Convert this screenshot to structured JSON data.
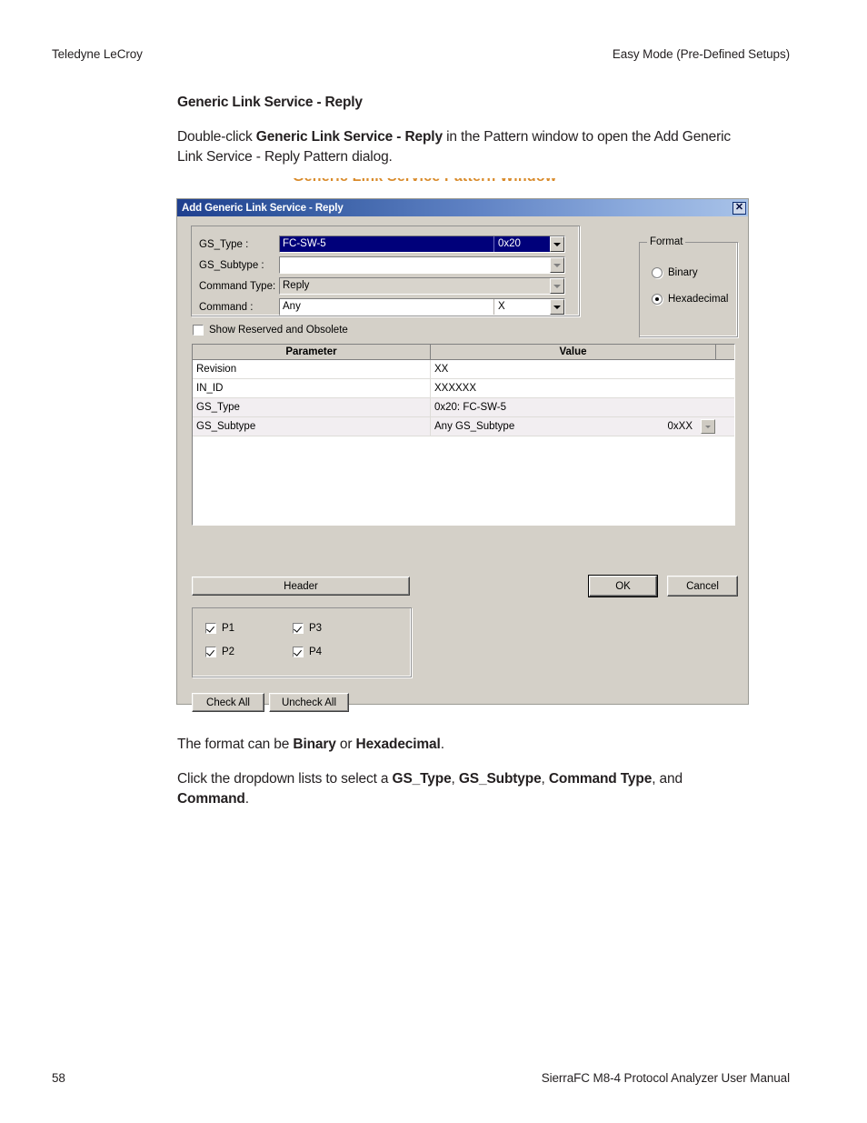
{
  "page": {
    "running_head_left": "Teledyne LeCroy",
    "running_head_right": "Easy Mode (Pre-Defined Setups)",
    "page_number": "58",
    "running_foot_right": "SierraFC M8-4 Protocol Analyzer User Manual",
    "section_title": "Generic Link Service - Reply",
    "paragraph1": {
      "part1": "Double-click ",
      "bold1": "Generic Link Service - Reply",
      "part2": " in the Pattern window to open the Add Generic Link Service - Reply Pattern dialog."
    },
    "clipped_caption": "Generic Link Service Pattern Window",
    "paragraph2": {
      "part1": "The format can be ",
      "bold1": "Binary",
      "part2": " or ",
      "bold2": "Hexadecimal",
      "part3": "."
    },
    "paragraph3": {
      "part1": "Click the dropdown lists to select a ",
      "bold1": "GS_Type",
      "part2": ", ",
      "bold2": "GS_Subtype",
      "part3": ", ",
      "bold3": "Command Type",
      "part4": ", and ",
      "bold4": "Command",
      "part5": "."
    }
  },
  "dialog": {
    "title": "Add Generic Link Service - Reply",
    "close_label": "✕",
    "fields": [
      {
        "label": "GS_Type :",
        "value": "FC-SW-5",
        "aux": "0x20",
        "state": "selected",
        "arrow": "enabled"
      },
      {
        "label": "GS_Subtype :",
        "value": "",
        "aux": "",
        "state": "white",
        "arrow": "disabled"
      },
      {
        "label": "Command Type:",
        "value": "Reply",
        "aux": "",
        "state": "grey",
        "arrow": "disabled"
      },
      {
        "label": "Command :",
        "value": "Any",
        "aux": "X",
        "state": "white",
        "arrow": "enabled"
      }
    ],
    "format": {
      "legend": "Format",
      "options": [
        {
          "label": "Binary",
          "checked": false
        },
        {
          "label": "Hexadecimal",
          "checked": true
        }
      ]
    },
    "show_reserved": {
      "label": "Show Reserved and Obsolete",
      "checked": false
    },
    "table": {
      "headers": [
        "Parameter",
        "Value",
        ""
      ],
      "rows": [
        {
          "parameter": "Revision",
          "value": "XX",
          "value_right": "",
          "dropdown": false,
          "alt": false
        },
        {
          "parameter": "IN_ID",
          "value": "XXXXXX",
          "value_right": "",
          "dropdown": false,
          "alt": false
        },
        {
          "parameter": "GS_Type",
          "value": "0x20: FC-SW-5",
          "value_right": "",
          "dropdown": false,
          "alt": true
        },
        {
          "parameter": "GS_Subtype",
          "value": "Any GS_Subtype",
          "value_right": "0xXX",
          "dropdown": true,
          "alt": true
        }
      ]
    },
    "buttons": {
      "header": "Header",
      "ok": "OK",
      "cancel": "Cancel",
      "check_all": "Check All",
      "uncheck_all": "Uncheck All"
    },
    "ports": [
      {
        "label": "P1",
        "checked": true
      },
      {
        "label": "P2",
        "checked": true
      },
      {
        "label": "P3",
        "checked": true
      },
      {
        "label": "P4",
        "checked": true
      }
    ]
  },
  "colors": {
    "title_bar_start": "#1f3f8f",
    "title_bar_end": "#a8c2e8",
    "dialog_face": "#d4d0c8",
    "selection_navy": "#00007a",
    "caption_orange": "#d98b2b",
    "row_alt": "#f2eef1"
  }
}
